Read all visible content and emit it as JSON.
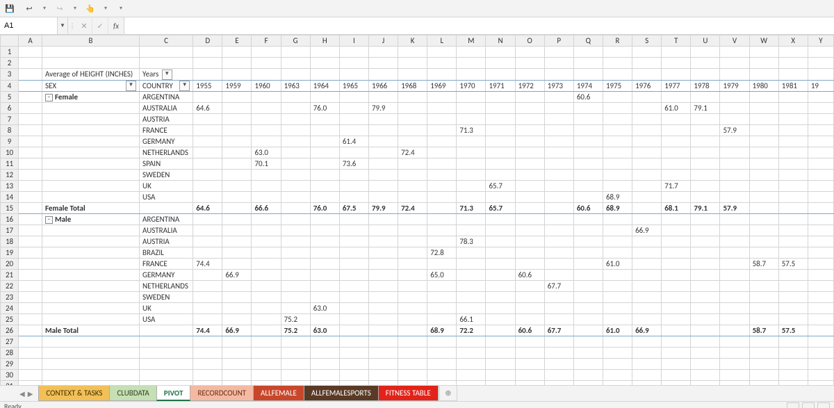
{
  "qat": {
    "save": "💾",
    "undo": "↩",
    "redo": "↪",
    "touch": "👆"
  },
  "namebox": {
    "value": "A1"
  },
  "fx": {
    "label": "fx",
    "x": "✕",
    "check": "✓"
  },
  "tabs": [
    {
      "label": "CONTEXT & TASKS",
      "bg": "#f2c057",
      "fg": "#433200",
      "active": false
    },
    {
      "label": "CLUBDATA",
      "bg": "#c5e0b4",
      "fg": "#344021",
      "active": false
    },
    {
      "label": "PIVOT",
      "bg": "#ffffff",
      "fg": "#217346",
      "active": true
    },
    {
      "label": "RECORDCOUNT",
      "bg": "#f4b9a3",
      "fg": "#6b2e12",
      "active": false
    },
    {
      "label": "ALLFEMALE",
      "bg": "#c8472b",
      "fg": "#ffffff",
      "active": false
    },
    {
      "label": "ALLFEMALESPORTS",
      "bg": "#5a3a26",
      "fg": "#ffffff",
      "active": false
    },
    {
      "label": "FITNESS TABLE",
      "bg": "#e22319",
      "fg": "#ffffff",
      "active": false
    }
  ],
  "status": {
    "ready": "Ready"
  },
  "cols": {
    "A": {
      "width": 40
    },
    "B": {
      "width": 135,
      "title": "Average of HEIGHT (INCHES)",
      "field1": "SEX",
      "groups": [
        {
          "label": "Female",
          "collapse": "-"
        },
        {
          "label": "Male",
          "collapse": "-"
        }
      ],
      "totals": [
        "Female Total",
        "Male Total"
      ]
    },
    "C": {
      "width": 70,
      "field2": "COUNTRY",
      "years_label": "Years"
    }
  },
  "year_cols": [
    "D",
    "E",
    "F",
    "G",
    "H",
    "I",
    "J",
    "K",
    "L",
    "M",
    "N",
    "O",
    "P",
    "Q",
    "R",
    "S",
    "T",
    "U",
    "V",
    "W",
    "X",
    "Y"
  ],
  "years": [
    "1955",
    "1959",
    "1960",
    "1963",
    "1964",
    "1965",
    "1966",
    "1968",
    "1969",
    "1970",
    "1971",
    "1972",
    "1973",
    "1974",
    "1975",
    "1976",
    "1977",
    "1978",
    "1979",
    "1980",
    "1981",
    "19"
  ],
  "female": {
    "countries": [
      "ARGENTINA",
      "AUSTRALIA",
      "AUSTRIA",
      "FRANCE",
      "GERMANY",
      "NETHERLANDS",
      "SPAIN",
      "SWEDEN",
      "UK",
      "USA"
    ],
    "values": [
      {
        "1974": "60.6"
      },
      {
        "1955": "64.6",
        "1964": "76.0",
        "1966": "79.9",
        "1977": "61.0",
        "1978": "79.1"
      },
      {},
      {
        "1970": "71.3",
        "1979": "57.9"
      },
      {
        "1965": "61.4"
      },
      {
        "1960": "63.0",
        "1968": "72.4"
      },
      {
        "1960": "70.1",
        "1965": "73.6"
      },
      {},
      {
        "1971": "65.7",
        "1977": "71.7"
      },
      {
        "1975": "68.9"
      }
    ],
    "total": {
      "1955": "64.6",
      "1960": "66.6",
      "1964": "76.0",
      "1965": "67.5",
      "1966": "79.9",
      "1968": "72.4",
      "1970": "71.3",
      "1971": "65.7",
      "1974": "60.6",
      "1975": "68.9",
      "1977": "68.1",
      "1978": "79.1",
      "1979": "57.9"
    }
  },
  "male": {
    "countries": [
      "ARGENTINA",
      "AUSTRALIA",
      "AUSTRIA",
      "BRAZIL",
      "FRANCE",
      "GERMANY",
      "NETHERLANDS",
      "SWEDEN",
      "UK",
      "USA"
    ],
    "values": [
      {},
      {
        "1976": "66.9"
      },
      {
        "1970": "78.3"
      },
      {
        "1969": "72.8"
      },
      {
        "1955": "74.4",
        "1975": "61.0",
        "1980": "58.7",
        "1981": "57.5"
      },
      {
        "1959": "66.9",
        "1969": "65.0",
        "1972": "60.6"
      },
      {
        "1973": "67.7"
      },
      {},
      {
        "1964": "63.0"
      },
      {
        "1963": "75.2",
        "1970": "66.1"
      }
    ],
    "total": {
      "1955": "74.4",
      "1959": "66.9",
      "1963": "75.2",
      "1964": "63.0",
      "1969": "68.9",
      "1970": "72.2",
      "1972": "60.6",
      "1973": "67.7",
      "1975": "61.0",
      "1976": "66.9",
      "1980": "58.7",
      "1981": "57.5"
    }
  }
}
